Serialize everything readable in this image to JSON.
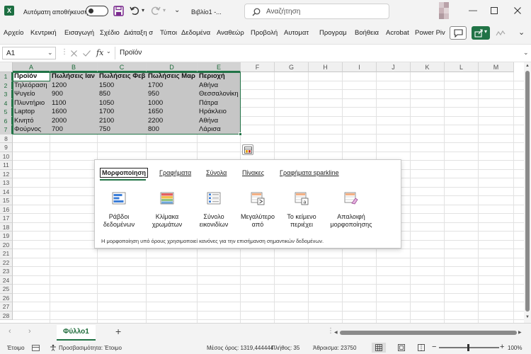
{
  "title_bar": {
    "autosave_label": "Αυτόματη αποθήκευση",
    "file_name": "Βιβλίο1 -...",
    "search_placeholder": "Αναζήτηση"
  },
  "ribbon_menu": [
    {
      "label": "Αρχείο"
    },
    {
      "label": "Κεντρική"
    },
    {
      "label": "Εισαγωγή"
    },
    {
      "label": "Σχέδιο"
    },
    {
      "label": "Διάταξη σ"
    },
    {
      "label": "Τύποι"
    },
    {
      "label": "Δεδομένα"
    },
    {
      "label": "Αναθεώρ"
    },
    {
      "label": "Προβολή"
    },
    {
      "label": "Αυτοματ"
    },
    {
      "label": "Προγραμ"
    },
    {
      "label": "Βοήθεια"
    },
    {
      "label": "Acrobat"
    },
    {
      "label": "Power Piv"
    }
  ],
  "formula_bar": {
    "name_box": "A1",
    "fx": "fx",
    "content": "Προϊόν"
  },
  "columns": [
    "A",
    "B",
    "C",
    "D",
    "E",
    "F",
    "G",
    "H",
    "I",
    "J",
    "K",
    "L",
    "M"
  ],
  "rows": [
    "1",
    "2",
    "3",
    "4",
    "5",
    "6",
    "7",
    "8",
    "9",
    "10",
    "11",
    "12",
    "13",
    "14",
    "15",
    "16",
    "17",
    "18",
    "19",
    "20",
    "21",
    "22",
    "23",
    "24",
    "25",
    "26",
    "27",
    "28"
  ],
  "sheet": {
    "headers": [
      "Προϊόν",
      "Πωλήσεις Ιαν",
      "Πωλήσεις Φεβ",
      "Πωλήσεις Μαρ",
      "Περιοχή"
    ],
    "data": [
      [
        "Τηλεόραση",
        "1200",
        "1500",
        "1700",
        "Αθήνα"
      ],
      [
        "Ψυγείο",
        "900",
        "850",
        "950",
        "Θεσσαλονίκη"
      ],
      [
        "Πλυντήριο",
        "1100",
        "1050",
        "1000",
        "Πάτρα"
      ],
      [
        "Laptop",
        "1600",
        "1700",
        "1650",
        "Ηράκλειο"
      ],
      [
        "Κινητό",
        "2000",
        "2100",
        "2200",
        "Αθήνα"
      ],
      [
        "Φούρνος",
        "700",
        "750",
        "800",
        "Λάρισα"
      ]
    ]
  },
  "quick_analysis": {
    "tabs": [
      {
        "label": "Μορφοποίηση",
        "active": true
      },
      {
        "label": "Γραφήματα"
      },
      {
        "label": "Σύνολα"
      },
      {
        "label": "Πίνακες"
      },
      {
        "label": "Γραφήματα sparkline"
      }
    ],
    "options": [
      {
        "line1": "Ράβδοι",
        "line2": "δεδομένων",
        "icon": "data-bars-icon"
      },
      {
        "line1": "Κλίμακα",
        "line2": "χρωμάτων",
        "icon": "color-scale-icon"
      },
      {
        "line1": "Σύνολο",
        "line2": "εικονιδίων",
        "icon": "icon-set-icon"
      },
      {
        "line1": "Μεγαλύτερο",
        "line2": "από",
        "icon": "greater-than-icon"
      },
      {
        "line1": "Το κείμενο",
        "line2": "περιέχει",
        "icon": "text-contains-icon"
      },
      {
        "line1": "Απαλοιφή",
        "line2": "μορφοποίησης",
        "icon": "clear-format-icon"
      }
    ],
    "description": "Η μορφοποίηση υπό όρους χρησιμοποιεί κανόνες για την επισήμανση σημαντικών δεδομένων."
  },
  "sheet_tabs": [
    {
      "label": "Φύλλο1"
    }
  ],
  "status_bar": {
    "ready": "Έτοιμο",
    "accessibility": "Προσβασιμότητα: Έτοιμο",
    "average": "Μέσος όρος: 1319,444444",
    "count": "Πλήθος: 35",
    "sum": "Άθροισμα: 23750",
    "minus": "−",
    "plus": "+",
    "zoom": "100%"
  },
  "colors": {
    "excel_green": "#217346",
    "selection_fill": "#c6c6c6",
    "header_selected": "#d3d3d3"
  }
}
